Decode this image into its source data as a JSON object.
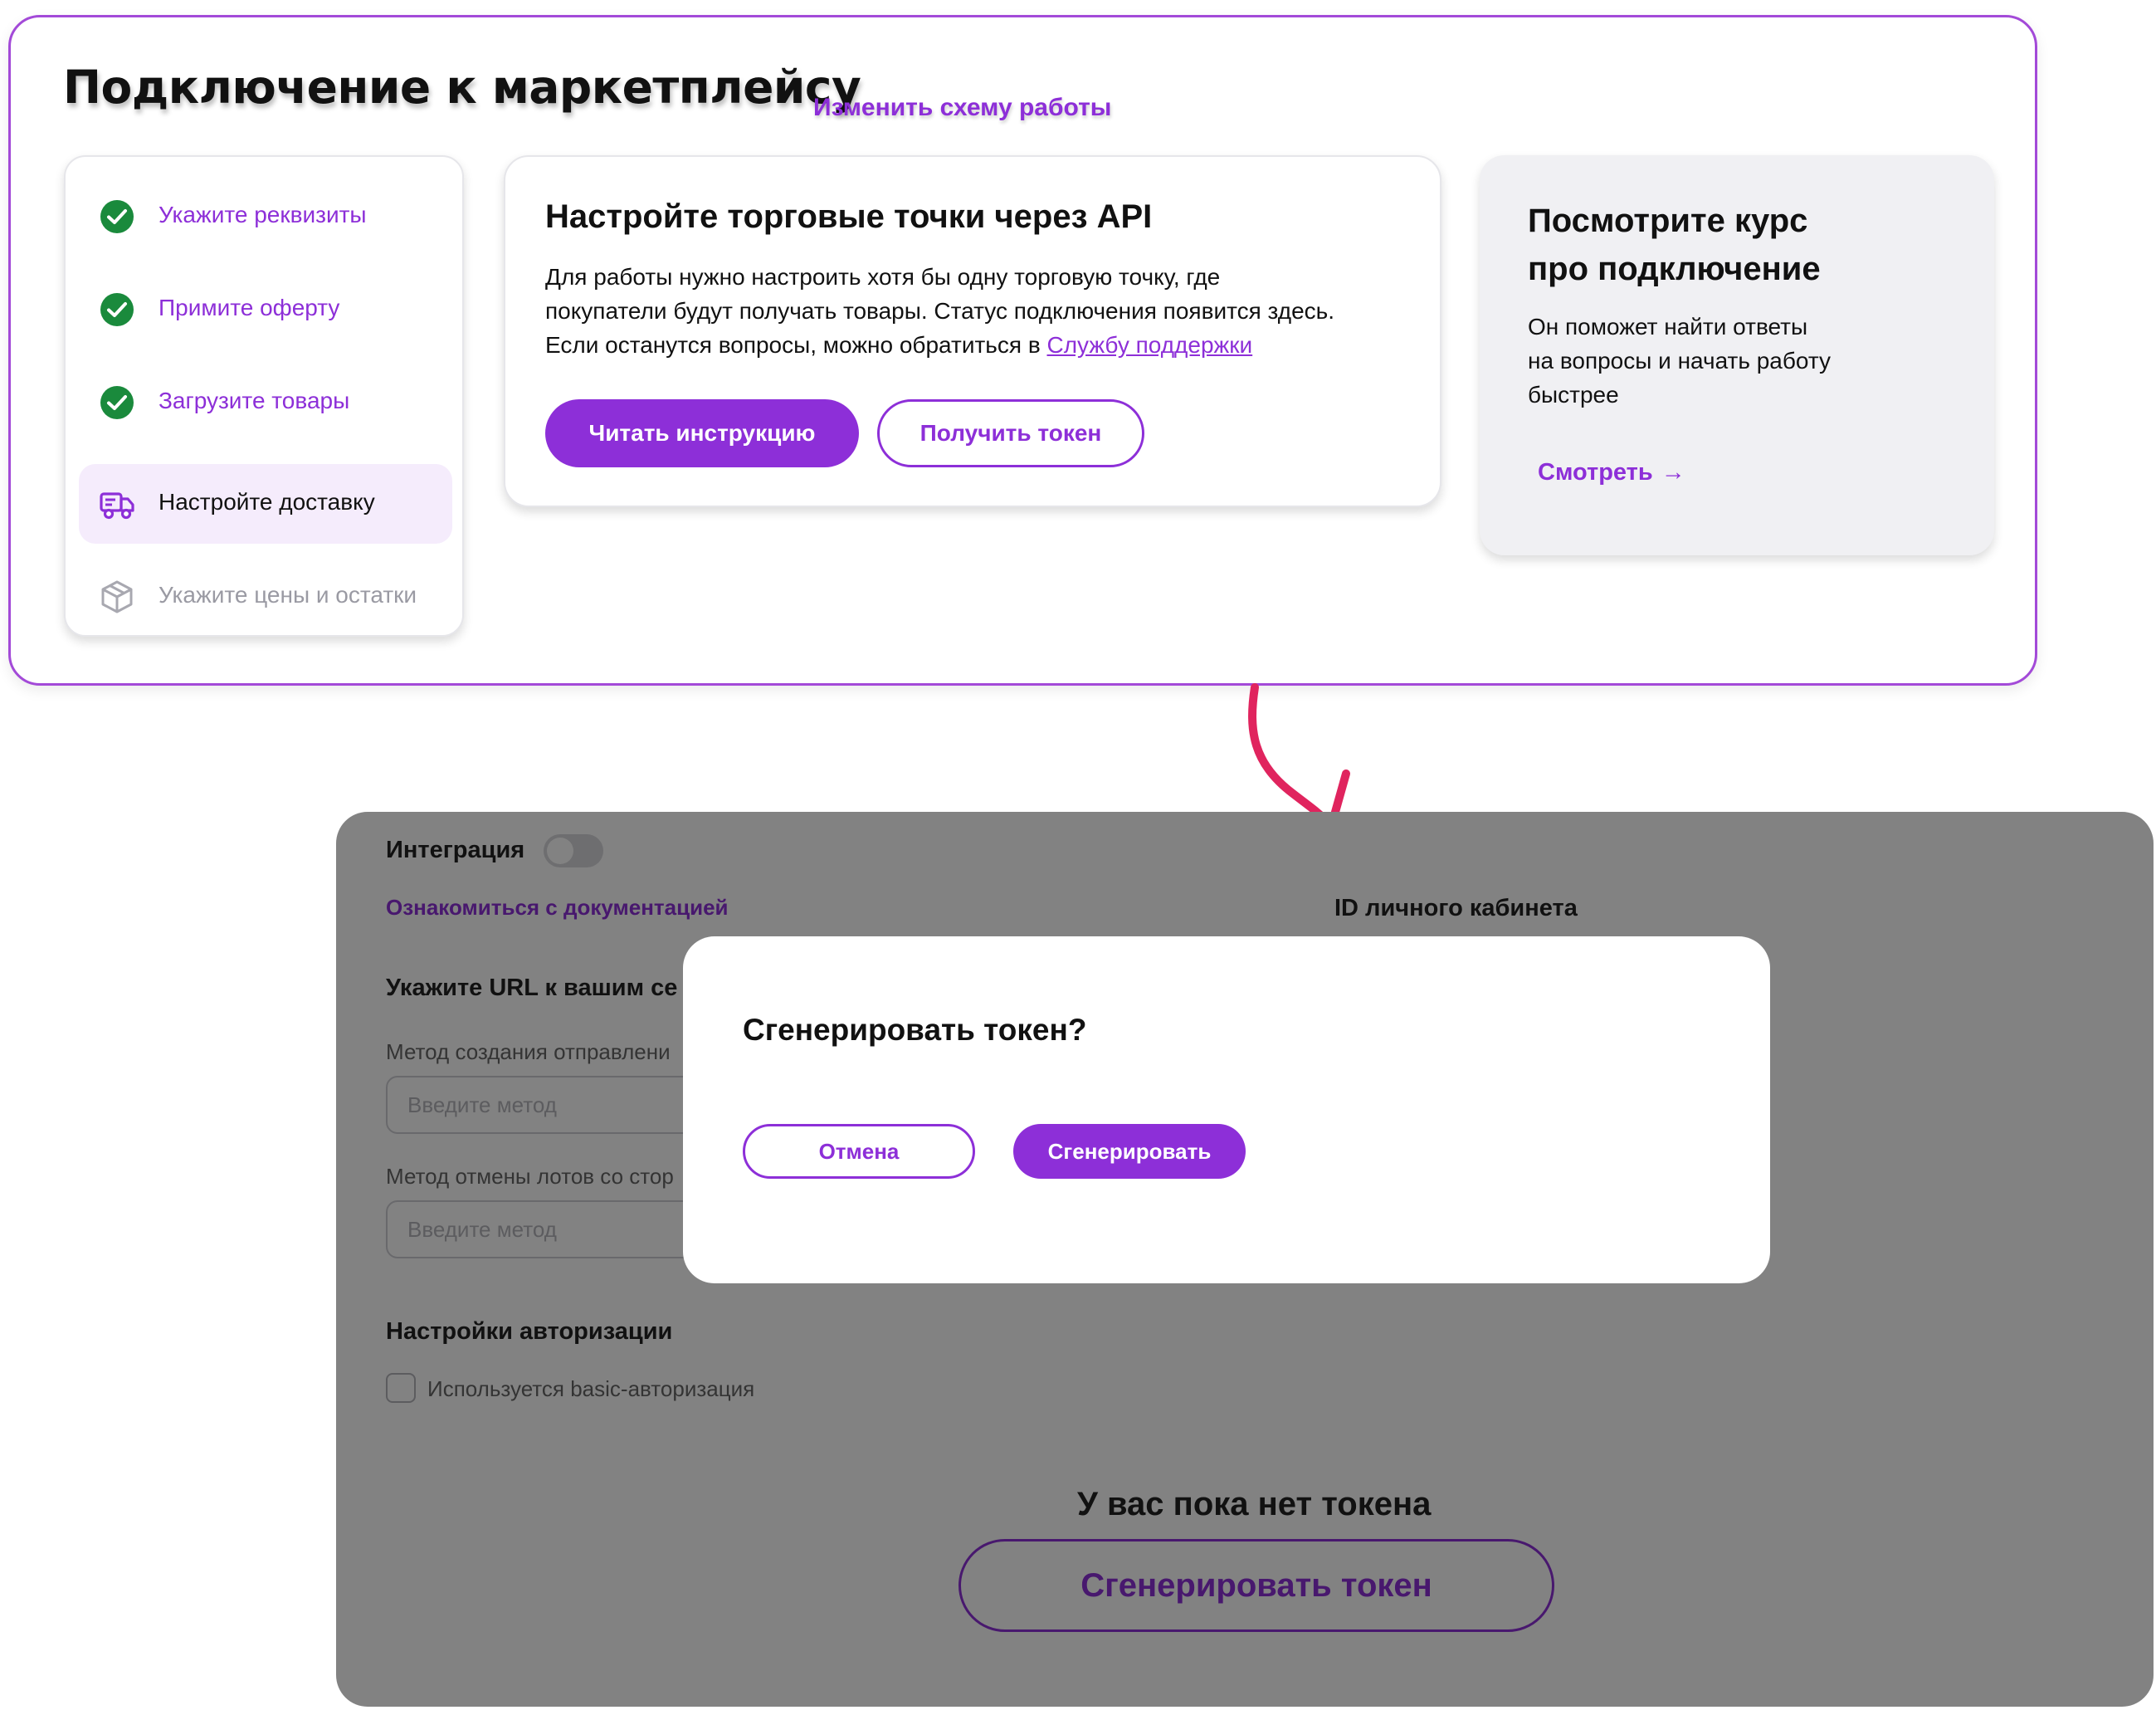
{
  "colors": {
    "accent": "#8d2fd8",
    "success": "#1a8a3c",
    "arrow": "#e0245e",
    "overlay": "rgba(0,0,0,0.49)"
  },
  "header": {
    "title": "Подключение к маркетплейсу",
    "change_link": "Изменить схему работы"
  },
  "steps": [
    {
      "label": "Укажите реквизиты",
      "state": "done",
      "icon": "check-circle-icon"
    },
    {
      "label": "Примите оферту",
      "state": "done",
      "icon": "check-circle-icon"
    },
    {
      "label": "Загрузите товары",
      "state": "done",
      "icon": "check-circle-icon"
    },
    {
      "label": "Настройте доставку",
      "state": "active",
      "icon": "truck-icon"
    },
    {
      "label": "Укажите цены и остатки",
      "state": "disabled",
      "icon": "box-icon"
    }
  ],
  "api_card": {
    "title": "Настройте торговые точки через API",
    "text_line1": "Для работы нужно настроить хотя бы одну торговую точку, где",
    "text_line2": "покупатели будут получать товары. Статус подключения появится здесь.",
    "text_line3": "Если останутся вопросы, можно обратиться в ",
    "support_link": "Службу поддержки",
    "read_button": "Читать инструкцию",
    "token_button": "Получить токен"
  },
  "course_card": {
    "title_line1": "Посмотрите курс",
    "title_line2": "про подключение",
    "text_line1": "Он поможет найти ответы",
    "text_line2": "на вопросы и начать работу",
    "text_line3": "быстрее",
    "watch_link": "Смотреть",
    "arrow": "→"
  },
  "integration_screen": {
    "integration_label": "Интеграция",
    "docs_link": "Ознакомиться с документацией",
    "cabinet_id_label": "ID личного кабинета",
    "url_section_title": "Укажите URL к вашим се",
    "method_create_label": "Метод создания отправлени",
    "method_cancel_label": "Метод отмены лотов со стор",
    "method_placeholder": "Введите метод",
    "auth_title": "Настройки авторизации",
    "basic_auth_label": "Используется basic-авторизация",
    "no_token_text": "У вас пока нет токена",
    "generate_token_button": "Сгенерировать токен"
  },
  "modal": {
    "title": "Сгенерировать токен?",
    "cancel_button": "Отмена",
    "generate_button": "Сгенерировать"
  }
}
